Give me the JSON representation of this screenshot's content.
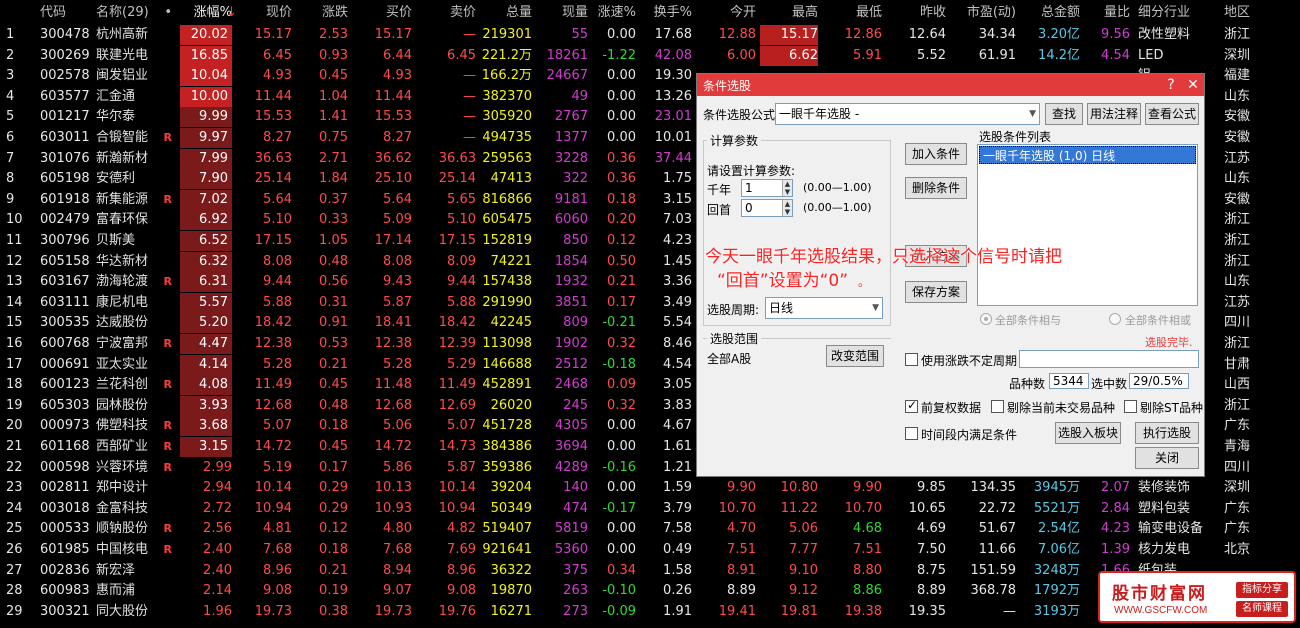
{
  "headers": [
    "",
    "代码",
    "名称(29)",
    "•",
    "涨幅%",
    "现价",
    "涨跌",
    "买价",
    "卖价",
    "总量",
    "现量",
    "涨速%",
    "换手%",
    "今开",
    "最高",
    "最低",
    "昨收",
    "市盈(动)",
    "总金额",
    "量比",
    "细分行业",
    "地区"
  ],
  "sort_arrow": "↓",
  "rows": [
    [
      "1",
      "300478",
      "杭州高新",
      "",
      "20.02",
      "15.17",
      "2.53",
      "15.17",
      "—",
      "219301",
      "55",
      "0.00",
      "17.68",
      "12.88",
      "15.17",
      "12.86",
      "12.64",
      "34.34",
      "3.20亿",
      "9.56",
      "改性塑料",
      "浙江"
    ],
    [
      "2",
      "300269",
      "联建光电",
      "",
      "16.85",
      "6.45",
      "0.93",
      "6.44",
      "6.45",
      "221.2万",
      "18261",
      "-1.22",
      "42.08",
      "6.00",
      "6.62",
      "5.91",
      "5.52",
      "61.91",
      "14.2亿",
      "4.54",
      "LED",
      "深圳"
    ],
    [
      "3",
      "002578",
      "闽发铝业",
      "",
      "10.04",
      "4.93",
      "0.45",
      "4.93",
      "—",
      "166.2万",
      "24667",
      "0.00",
      "19.30",
      "",
      "",
      "",
      "",
      "",
      "",
      "",
      "铝",
      "福建"
    ],
    [
      "4",
      "603577",
      "汇金通",
      "",
      "10.00",
      "11.44",
      "1.04",
      "11.44",
      "—",
      "382370",
      "49",
      "0.00",
      "13.26",
      "",
      "",
      "",
      "",
      "",
      "",
      "",
      "",
      "山东"
    ],
    [
      "5",
      "001217",
      "华尔泰",
      "",
      "9.99",
      "15.53",
      "1.41",
      "15.53",
      "—",
      "305920",
      "2767",
      "0.00",
      "23.01",
      "",
      "",
      "",
      "",
      "",
      "",
      "",
      "",
      "安徽"
    ],
    [
      "6",
      "603011",
      "合锻智能",
      "R",
      "9.97",
      "8.27",
      "0.75",
      "8.27",
      "—",
      "494735",
      "1377",
      "0.00",
      "10.01",
      "",
      "",
      "",
      "",
      "",
      "",
      "",
      "",
      "安徽"
    ],
    [
      "7",
      "301076",
      "新瀚新材",
      "",
      "7.99",
      "36.63",
      "2.71",
      "36.62",
      "36.63",
      "259563",
      "3228",
      "0.36",
      "37.44",
      "",
      "",
      "",
      "",
      "",
      "",
      "",
      "",
      "江苏"
    ],
    [
      "8",
      "605198",
      "安德利",
      "",
      "7.90",
      "25.14",
      "1.84",
      "25.10",
      "25.14",
      "47413",
      "322",
      "0.36",
      "1.75",
      "",
      "",
      "",
      "",
      "",
      "",
      "",
      "",
      "山东"
    ],
    [
      "9",
      "601918",
      "新集能源",
      "R",
      "7.02",
      "5.64",
      "0.37",
      "5.64",
      "5.65",
      "816866",
      "9181",
      "0.18",
      "3.15",
      "",
      "",
      "",
      "",
      "",
      "",
      "",
      "",
      "安徽"
    ],
    [
      "10",
      "002479",
      "富春环保",
      "",
      "6.92",
      "5.10",
      "0.33",
      "5.09",
      "5.10",
      "605475",
      "6060",
      "0.20",
      "7.03",
      "",
      "",
      "",
      "",
      "",
      "",
      "",
      "",
      "浙江"
    ],
    [
      "11",
      "300796",
      "贝斯美",
      "",
      "6.52",
      "17.15",
      "1.05",
      "17.14",
      "17.15",
      "152819",
      "850",
      "0.12",
      "4.23",
      "",
      "",
      "",
      "",
      "",
      "",
      "",
      "",
      "浙江"
    ],
    [
      "12",
      "605158",
      "华达新材",
      "",
      "6.32",
      "8.08",
      "0.48",
      "8.08",
      "8.09",
      "74221",
      "1854",
      "0.50",
      "1.45",
      "",
      "",
      "",
      "",
      "",
      "",
      "",
      "",
      "浙江"
    ],
    [
      "13",
      "603167",
      "渤海轮渡",
      "R",
      "6.31",
      "9.44",
      "0.56",
      "9.43",
      "9.44",
      "157438",
      "1932",
      "0.21",
      "3.36",
      "",
      "",
      "",
      "",
      "",
      "",
      "",
      "",
      "山东"
    ],
    [
      "14",
      "603111",
      "康尼机电",
      "",
      "5.57",
      "5.88",
      "0.31",
      "5.87",
      "5.88",
      "291990",
      "3851",
      "0.17",
      "3.49",
      "",
      "",
      "",
      "",
      "",
      "",
      "",
      "",
      "江苏"
    ],
    [
      "15",
      "300535",
      "达威股份",
      "",
      "5.20",
      "18.42",
      "0.91",
      "18.41",
      "18.42",
      "42245",
      "809",
      "-0.21",
      "5.54",
      "",
      "",
      "",
      "",
      "",
      "",
      "",
      "",
      "四川"
    ],
    [
      "16",
      "600768",
      "宁波富邦",
      "R",
      "4.47",
      "12.38",
      "0.53",
      "12.38",
      "12.39",
      "113098",
      "1902",
      "0.32",
      "8.46",
      "",
      "",
      "",
      "",
      "",
      "",
      "",
      "",
      "浙江"
    ],
    [
      "17",
      "000691",
      "亚太实业",
      "",
      "4.14",
      "5.28",
      "0.21",
      "5.28",
      "5.29",
      "146688",
      "2512",
      "-0.18",
      "4.54",
      "",
      "",
      "",
      "",
      "",
      "",
      "",
      "",
      "甘肃"
    ],
    [
      "18",
      "600123",
      "兰花科创",
      "R",
      "4.08",
      "11.49",
      "0.45",
      "11.48",
      "11.49",
      "452891",
      "2468",
      "0.09",
      "3.05",
      "",
      "",
      "",
      "",
      "",
      "",
      "",
      "",
      "山西"
    ],
    [
      "19",
      "605303",
      "园林股份",
      "",
      "3.93",
      "12.68",
      "0.48",
      "12.68",
      "12.69",
      "26020",
      "245",
      "0.32",
      "3.83",
      "",
      "",
      "",
      "",
      "",
      "",
      "",
      "",
      "浙江"
    ],
    [
      "20",
      "000973",
      "佛塑科技",
      "R",
      "3.68",
      "5.07",
      "0.18",
      "5.06",
      "5.07",
      "451728",
      "4305",
      "0.00",
      "4.67",
      "",
      "",
      "",
      "",
      "",
      "",
      "",
      "",
      "广东"
    ],
    [
      "21",
      "601168",
      "西部矿业",
      "R",
      "3.15",
      "14.72",
      "0.45",
      "14.72",
      "14.73",
      "384386",
      "3694",
      "0.00",
      "1.61",
      "",
      "",
      "",
      "",
      "",
      "",
      "",
      "",
      "青海"
    ],
    [
      "22",
      "000598",
      "兴蓉环境",
      "R",
      "2.99",
      "5.19",
      "0.17",
      "5.86",
      "5.87",
      "359386",
      "4289",
      "-0.16",
      "1.21",
      "",
      "",
      "",
      "",
      "",
      "",
      "",
      "",
      "四川"
    ],
    [
      "23",
      "002811",
      "郑中设计",
      "",
      "2.94",
      "10.14",
      "0.29",
      "10.13",
      "10.14",
      "39204",
      "140",
      "0.00",
      "1.59",
      "9.90",
      "10.80",
      "9.90",
      "9.85",
      "134.35",
      "3945万",
      "2.07",
      "装修装饰",
      "深圳"
    ],
    [
      "24",
      "003018",
      "金富科技",
      "",
      "2.72",
      "10.94",
      "0.29",
      "10.93",
      "10.94",
      "50349",
      "474",
      "-0.17",
      "3.79",
      "10.70",
      "11.22",
      "10.70",
      "10.65",
      "22.72",
      "5521万",
      "2.84",
      "塑料包装",
      "广东"
    ],
    [
      "25",
      "000533",
      "顺钠股份",
      "R",
      "2.56",
      "4.81",
      "0.12",
      "4.80",
      "4.82",
      "519407",
      "5819",
      "0.00",
      "7.58",
      "4.70",
      "5.06",
      "4.68",
      "4.69",
      "51.67",
      "2.54亿",
      "4.23",
      "输变电设备",
      "广东"
    ],
    [
      "26",
      "601985",
      "中国核电",
      "R",
      "2.40",
      "7.68",
      "0.18",
      "7.68",
      "7.69",
      "921641",
      "5360",
      "0.00",
      "0.49",
      "7.51",
      "7.77",
      "7.51",
      "7.50",
      "11.66",
      "7.06亿",
      "1.39",
      "核力发电",
      "北京"
    ],
    [
      "27",
      "002836",
      "新宏泽",
      "",
      "2.40",
      "8.96",
      "0.21",
      "8.94",
      "8.96",
      "36322",
      "375",
      "0.34",
      "1.58",
      "8.91",
      "9.10",
      "8.80",
      "8.75",
      "151.59",
      "3248万",
      "1.66",
      "纸包装",
      ""
    ],
    [
      "28",
      "600983",
      "惠而浦",
      "",
      "2.14",
      "9.08",
      "0.19",
      "9.07",
      "9.08",
      "19870",
      "263",
      "-0.10",
      "0.26",
      "8.89",
      "9.12",
      "8.86",
      "8.89",
      "368.78",
      "1792万",
      "",
      "",
      ""
    ],
    [
      "29",
      "300321",
      "同大股份",
      "",
      "1.96",
      "19.73",
      "0.38",
      "19.73",
      "19.76",
      "16271",
      "273",
      "-0.09",
      "1.91",
      "19.41",
      "19.81",
      "19.38",
      "19.35",
      "—",
      "3193万",
      "",
      "",
      ""
    ]
  ],
  "dialog": {
    "title": "条件选股",
    "formula_label": "条件选股公式",
    "formula_value": "一眼千年选股  -",
    "find_btn": "查找",
    "usage_btn": "用法注释",
    "view_btn": "查看公式",
    "params_group": "计算参数",
    "params_prompt": "请设置计算参数:",
    "param1_label": "千年",
    "param1_value": "1",
    "param1_range": "(0.00—1.00)",
    "param2_label": "回首",
    "param2_value": "0",
    "param2_range": "(0.00—1.00)",
    "add_btn": "加入条件",
    "del_btn": "删除条件",
    "import_btn": "引入方案",
    "save_btn": "保存方案",
    "list_label": "选股条件列表",
    "list_item": "一眼千年选股 (1,0) 日线",
    "period_label": "选股周期:",
    "period_value": "日线",
    "radio_and": "全部条件相与",
    "radio_or": "全部条件相或",
    "done_status": "选股完毕.",
    "range_group": "选股范围",
    "range_value": "全部A股",
    "change_range_btn": "改变范围",
    "use_range_label": "使用涨跌不定周期",
    "count_label": "品种数",
    "count_value": "5344",
    "selected_label": "选中数",
    "selected_value": "29/0.5%",
    "adj_label": "前复权数据",
    "excl_untraded_label": "剔除当前未交易品种",
    "excl_st_label": "剔除ST品种",
    "time_cond_label": "时间段内满足条件",
    "to_board_btn": "选股入板块",
    "exec_btn": "执行选股",
    "close_btn": "关闭"
  },
  "annotation_line1": "今天一眼千年选股结果，只选择这个信号时请把",
  "annotation_line2": "“回首”设置为“0”",
  "annotation_dot": "。",
  "watermark": {
    "cn": "股市财富网",
    "url": "WWW.GSCFW.COM",
    "tag1": "指标分享",
    "tag2": "名师课程"
  }
}
